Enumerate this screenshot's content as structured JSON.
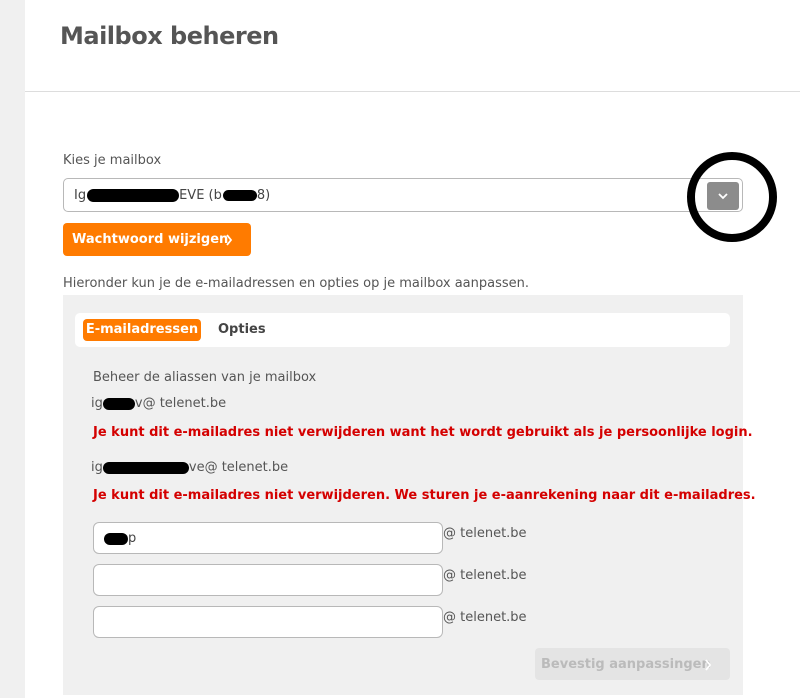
{
  "header": {
    "title": "Mailbox beheren"
  },
  "mailbox_select": {
    "label": "Kies je mailbox",
    "value_prefix": "Ig",
    "value_middle": "EVE (b",
    "value_suffix": "8)",
    "toggle_icon": "chevron-down-icon"
  },
  "password_button": {
    "label": "Wachtwoord wijzigen",
    "icon": "chevron-right-icon"
  },
  "intro": "Hieronder kun je de e-mailadressen en opties op je mailbox aanpassen.",
  "tabs": [
    {
      "label": "E-mailadressen",
      "active": true
    },
    {
      "label": "Opties",
      "active": false
    }
  ],
  "aliases": {
    "heading": "Beheer de aliassen van je mailbox",
    "existing": [
      {
        "prefix": "ig",
        "suffix": "v@ telenet.be",
        "warning": "Je kunt dit e-mailadres niet verwijderen want het wordt gebruikt als je persoonlijke login."
      },
      {
        "prefix": "ig",
        "suffix": "ve@ telenet.be",
        "warning": "Je kunt dit e-mailadres niet verwijderen. We sturen je e-aanrekening naar dit e-mailadres."
      }
    ],
    "inputs": [
      {
        "value": "p",
        "domain": "@ telenet.be"
      },
      {
        "value": "",
        "domain": "@ telenet.be"
      },
      {
        "value": "",
        "domain": "@ telenet.be"
      }
    ]
  },
  "confirm_button": {
    "label": "Bevestig aanpassingen",
    "icon": "chevron-right-icon",
    "enabled": false
  },
  "colors": {
    "accent": "#ff7b00",
    "error": "#d40000",
    "panel_bg": "#f0f0f0"
  }
}
